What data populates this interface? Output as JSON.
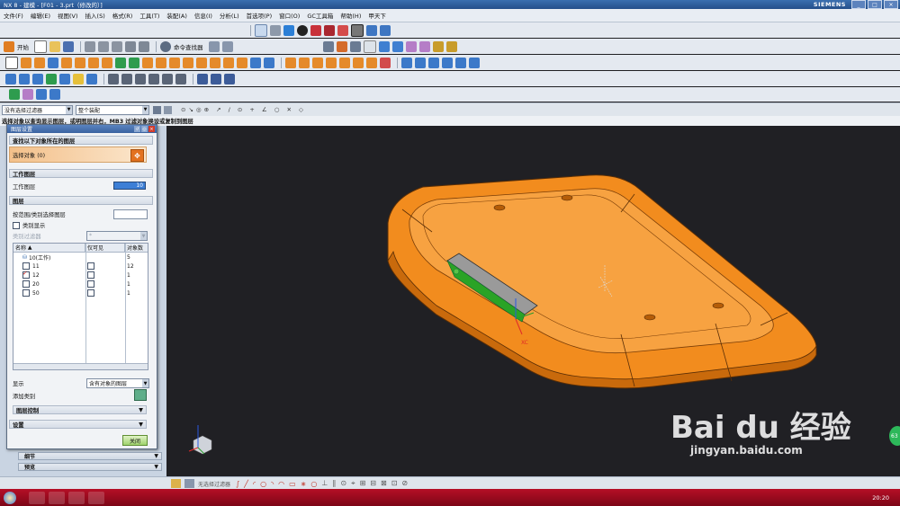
{
  "titlebar": {
    "title": "NX 8 - 建模 - [F01 - 3.prt（修改的）]",
    "brand": "SIEMENS",
    "controls": [
      "_",
      "□",
      "×"
    ]
  },
  "menu": [
    "文件(F)",
    "编辑(E)",
    "视图(V)",
    "插入(S)",
    "格式(R)",
    "工具(T)",
    "装配(A)",
    "信息(I)",
    "分析(L)",
    "首选项(P)",
    "窗口(O)",
    "GC工具箱",
    "帮助(H)",
    "甲天下"
  ],
  "toolbar": {
    "start_label": "开始",
    "command_finder_label": "命令查找器"
  },
  "selection": {
    "filter": "没有选择过滤器",
    "scope": "整个装配"
  },
  "cue": "选择对象以查询显示图层，或明图层并右，MB3 过滤对象换设或复制到图层",
  "dialog": {
    "title": "图层设置",
    "section_find": "查找以下对象所在的图层",
    "select_object": "选择对象 (0)",
    "section_work": "工作图层",
    "work_layer_label": "工作图层",
    "work_layer_value": "10",
    "section_layers": "图层",
    "by_range_label": "按范围/类别选择图层",
    "show_category": "类别显示",
    "category_filter_label": "类别过滤器",
    "category_filter_value": "*",
    "columns": [
      "名称",
      "仅可见",
      "对象数"
    ],
    "rows": [
      {
        "name": "10(工作)",
        "count": "5"
      },
      {
        "name": "11",
        "count": "12"
      },
      {
        "name": "12",
        "count": "1"
      },
      {
        "name": "20",
        "count": "1"
      },
      {
        "name": "50",
        "count": "1"
      }
    ],
    "display_label": "显示",
    "display_value": "含有对象的图层",
    "add_category": "添加类别",
    "layer_control": "图层控制",
    "settings": "设置",
    "close": "关闭"
  },
  "side_panels": [
    "细节",
    "预览"
  ],
  "statusbar": {
    "label": "无选择过滤器"
  },
  "taskbar": {
    "clock": "20:20"
  },
  "watermark": {
    "brand": "Bai du 经验",
    "url": "jingyan.baidu.com"
  },
  "badge": "63",
  "colors": {
    "part": "#f28c1e",
    "viewport": "#202024",
    "taskbar": "#a30a1f"
  }
}
